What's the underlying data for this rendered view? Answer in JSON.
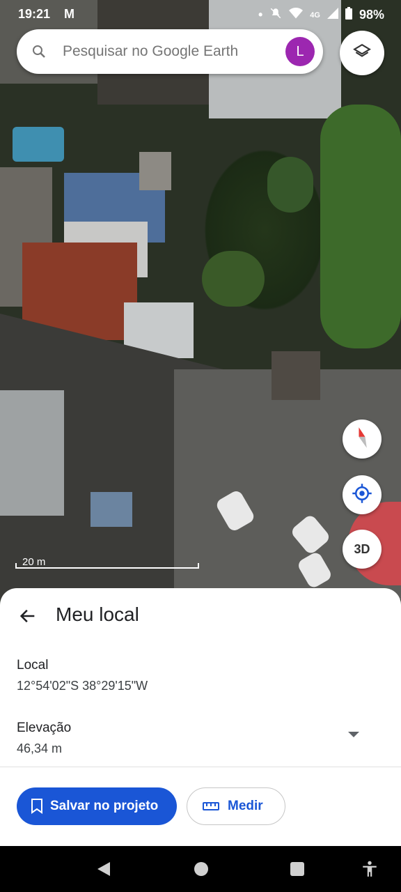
{
  "status_bar": {
    "time": "19:21",
    "network": "4G",
    "battery": "98%"
  },
  "search": {
    "placeholder": "Pesquisar no Google Earth",
    "avatar_letter": "L"
  },
  "map": {
    "scale_label": "20 m",
    "view_3d_label": "3D"
  },
  "sheet": {
    "title": "Meu local",
    "location_label": "Local",
    "location_value": "12°54'02\"S 38°29'15\"W",
    "elevation_label": "Elevação",
    "elevation_value": "46,34 m",
    "save_button": "Salvar no projeto",
    "measure_button": "Medir"
  },
  "colors": {
    "accent": "#1a56d6",
    "avatar": "#9c27b0",
    "compass_red": "#e53935"
  }
}
